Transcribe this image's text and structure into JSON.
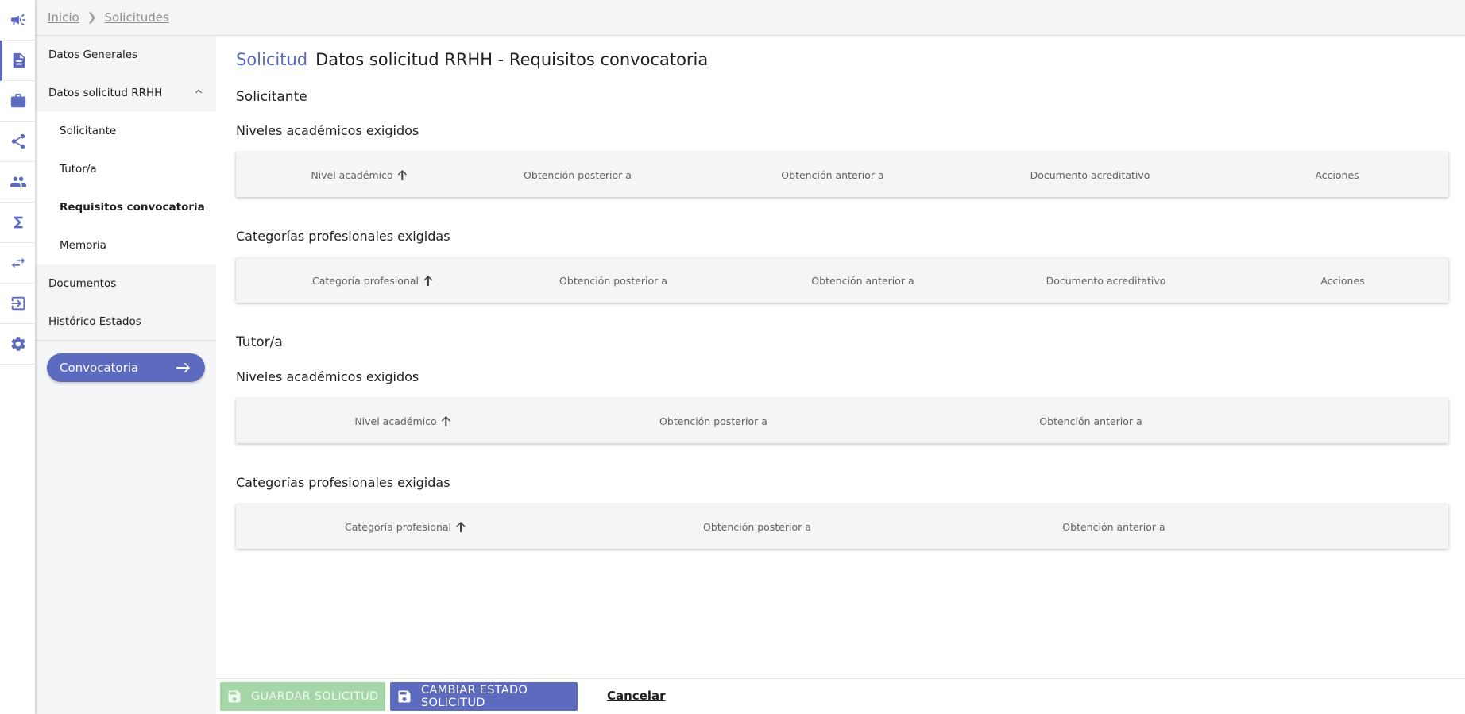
{
  "breadcrumb": {
    "items": [
      "Inicio",
      "Solicitudes"
    ]
  },
  "rail": {
    "icons": [
      "megaphone-icon",
      "document-icon",
      "briefcase-icon",
      "share-icon",
      "people-icon",
      "sigma-icon",
      "swap-icon",
      "logout-icon",
      "gear-icon"
    ],
    "active_index": 1,
    "accent": "#5c6bc0"
  },
  "sidemenu": {
    "items": [
      {
        "label": "Datos Generales",
        "type": "top"
      },
      {
        "label": "Datos solicitud RRHH",
        "type": "top",
        "expanded": true
      },
      {
        "label": "Solicitante",
        "type": "sub"
      },
      {
        "label": "Tutor/a",
        "type": "sub"
      },
      {
        "label": "Requisitos convocatoria",
        "type": "sub",
        "selected": true
      },
      {
        "label": "Memoria",
        "type": "sub"
      },
      {
        "label": "Documentos",
        "type": "top"
      },
      {
        "label": "Histórico Estados",
        "type": "top"
      }
    ],
    "convocatoria_button": "Convocatoria"
  },
  "page": {
    "title_prefix": "Solicitud",
    "title": "Datos solicitud RRHH - Requisitos convocatoria"
  },
  "solicitante": {
    "heading": "Solicitante",
    "niveles": {
      "heading": "Niveles académicos exigidos",
      "columns": [
        "Nivel académico",
        "Obtención posterior a",
        "Obtención anterior a",
        "Documento acreditativo",
        "Acciones"
      ]
    },
    "categorias": {
      "heading": "Categorías profesionales exigidas",
      "columns": [
        "Categoría profesional",
        "Obtención posterior a",
        "Obtención anterior a",
        "Documento acreditativo",
        "Acciones"
      ]
    }
  },
  "tutor": {
    "heading": "Tutor/a",
    "niveles": {
      "heading": "Niveles académicos exigidos",
      "columns": [
        "Nivel académico",
        "Obtención posterior a",
        "Obtención anterior a"
      ]
    },
    "categorias": {
      "heading": "Categorías profesionales exigidas",
      "columns": [
        "Categoría profesional",
        "Obtención posterior a",
        "Obtención anterior a"
      ]
    }
  },
  "actions": {
    "save": "GUARDAR SOLICITUD",
    "change_state": "CAMBIAR ESTADO SOLICITUD",
    "cancel": "Cancelar"
  },
  "colors": {
    "accent": "#5c6bc0",
    "save_disabled": "#a5d6a7",
    "panel_bg": "#f4f5f7"
  }
}
